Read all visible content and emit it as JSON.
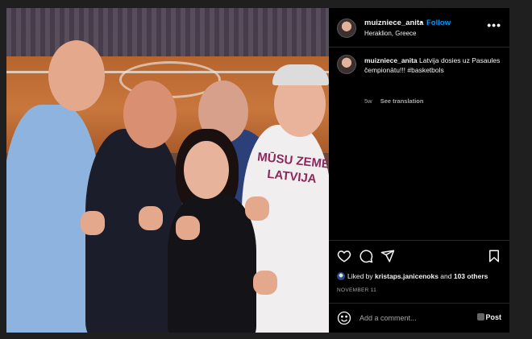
{
  "header": {
    "username": "muizniece_anita",
    "separator": "•",
    "follow_label": "Follow",
    "location": "Heraklion, Greece",
    "more_icon": "more-horizontal-icon"
  },
  "caption": {
    "username": "muizniece_anita",
    "text": "Latvija dosies uz Pasaules čempionātu!!! #basketbols",
    "age": "5w",
    "see_translation": "See translation"
  },
  "photo": {
    "shirt_text": "MŪSU ZEME LATVIJA"
  },
  "actions": {
    "like_icon": "heart-icon",
    "comment_icon": "comment-icon",
    "share_icon": "send-icon",
    "save_icon": "bookmark-icon"
  },
  "likes": {
    "prefix": "Liked by ",
    "user": "kristaps.janicenoks",
    "middle": " and ",
    "others": "103 others"
  },
  "date": "NOVEMBER 11",
  "comment": {
    "placeholder": "Add a comment...",
    "post_label": "Post"
  },
  "colors": {
    "accent": "#0095f6",
    "background": "#000000",
    "text": "#f5f5f5",
    "muted": "#a8a8a8"
  }
}
